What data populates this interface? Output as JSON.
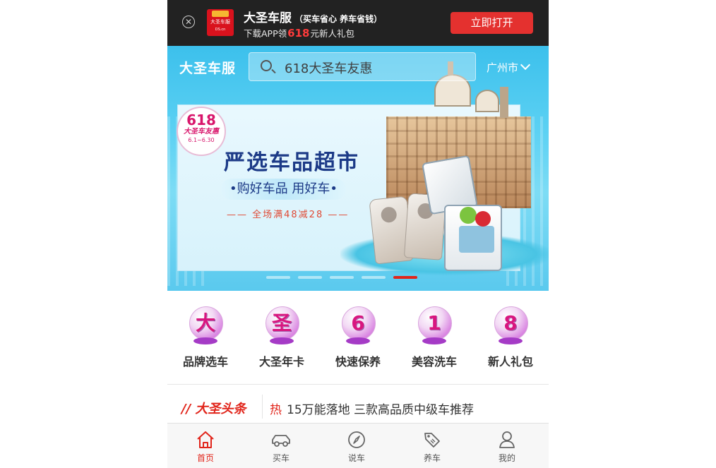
{
  "download_bar": {
    "close_icon": "close-icon",
    "app_logo_text": "大圣车服",
    "app_logo_sub": "DS.cn",
    "app_name": "大圣车服",
    "slogan": "（买车省心 养车省钱）",
    "promo_prefix": "下载APP领",
    "promo_amount": "618",
    "promo_suffix": "元新人礼包",
    "open_button": "立即打开",
    "button_color": "#e4312f"
  },
  "header": {
    "logo": "大圣车服",
    "search_placeholder": "618大圣车友惠",
    "city": "广州市",
    "search_icon": "search-icon",
    "city_icon": "chevron-down-icon"
  },
  "banner": {
    "badge_number": "618",
    "badge_name": "大圣车友惠",
    "badge_date": "6.1~6.30",
    "headline": "严选车品超市",
    "tagline": "•购好车品 用好车•",
    "offer": "—— 全场满48减28 ——",
    "slide_count": 5,
    "active_slide": 5
  },
  "categories": [
    {
      "label": "品牌选车",
      "glyph": "大",
      "icon": "brand-car-icon"
    },
    {
      "label": "大圣年卡",
      "glyph": "圣",
      "icon": "annual-card-icon"
    },
    {
      "label": "快速保养",
      "glyph": "6",
      "icon": "quick-maintenance-icon"
    },
    {
      "label": "美容洗车",
      "glyph": "1",
      "icon": "car-wash-icon"
    },
    {
      "label": "新人礼包",
      "glyph": "8",
      "icon": "gift-package-icon"
    }
  ],
  "news": {
    "logo": "// 大圣头条",
    "tag": "热",
    "title": "15万能落地 三款高品质中级车推荐"
  },
  "tabbar": [
    {
      "label": "首页",
      "icon": "home-icon",
      "active": true
    },
    {
      "label": "买车",
      "icon": "car-icon",
      "active": false
    },
    {
      "label": "说车",
      "icon": "compass-icon",
      "active": false
    },
    {
      "label": "养车",
      "icon": "tag-icon",
      "active": false
    },
    {
      "label": "我的",
      "icon": "user-icon",
      "active": false
    }
  ],
  "colors": {
    "accent_red": "#e1251b",
    "banner_blue": "#3cc0ec",
    "headline_navy": "#1c3a87"
  }
}
